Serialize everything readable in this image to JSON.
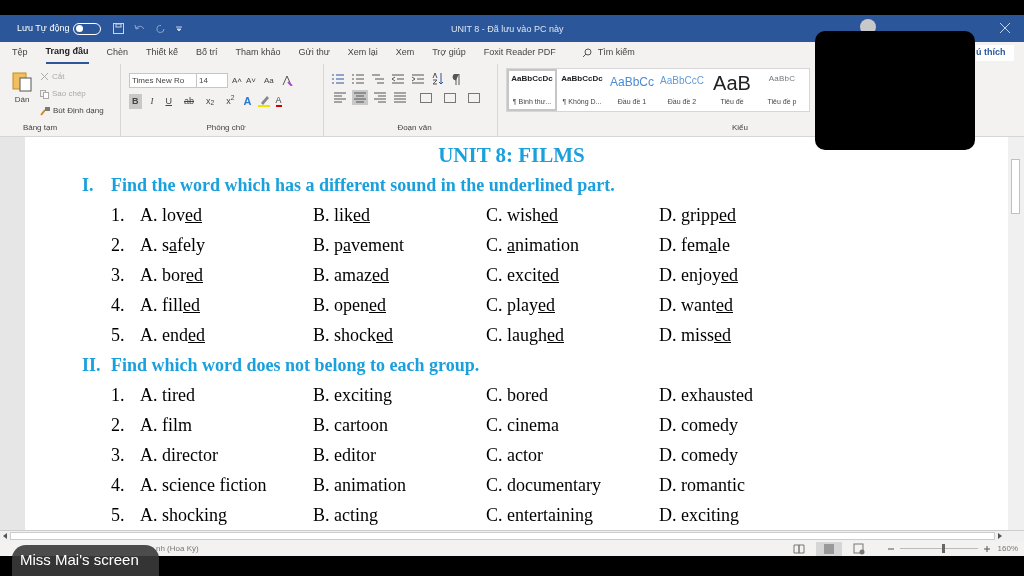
{
  "title_bar": {
    "autosave_label": "Lưu Tự động",
    "autosave_on": false,
    "title": "UNIT 8  -  Đã lưu vào PC này"
  },
  "menu_tabs": [
    {
      "label": "Tệp",
      "selected": false
    },
    {
      "label": "Trang đầu",
      "selected": true
    },
    {
      "label": "Chèn",
      "selected": false
    },
    {
      "label": "Thiết kế",
      "selected": false
    },
    {
      "label": "Bố trí",
      "selected": false
    },
    {
      "label": "Tham khảo",
      "selected": false
    },
    {
      "label": "Gửi thư",
      "selected": false
    },
    {
      "label": "Xem lại",
      "selected": false
    },
    {
      "label": "Xem",
      "selected": false
    },
    {
      "label": "Trợ giúp",
      "selected": false
    },
    {
      "label": "Foxit Reader PDF",
      "selected": false
    }
  ],
  "search": {
    "placeholder": "Tìm kiếm"
  },
  "comments_button": "ú thích",
  "ribbon": {
    "clipboard": {
      "paste": "Dán",
      "cut": "Cắt",
      "copy": "Sao chép",
      "format_painter": "Bút Định dạng",
      "group": "Bảng tạm"
    },
    "font": {
      "name": "Times New Ro",
      "size": "14",
      "size_buttons": [
        "A˄",
        "A˅"
      ],
      "text_effects": "A",
      "font_color": "A",
      "case": "Aa",
      "group": "Phông chữ",
      "format_buttons": [
        {
          "kind": "bold",
          "label": "B",
          "selected": true
        },
        {
          "kind": "italic",
          "label": "I",
          "selected": false
        },
        {
          "kind": "underline",
          "label": "U",
          "selected": false
        },
        {
          "kind": "strike",
          "label": "ab",
          "selected": false
        },
        {
          "kind": "subscript",
          "label": "x",
          "mark": "2",
          "selected": false
        },
        {
          "kind": "superscript",
          "label": "x",
          "mark": "2",
          "selected": false
        }
      ]
    },
    "paragraph": {
      "group": "Đoạn văn",
      "align_buttons": [
        {
          "kind": "left",
          "selected": false
        },
        {
          "kind": "center",
          "selected": true
        },
        {
          "kind": "right",
          "selected": false
        },
        {
          "kind": "justify",
          "selected": false
        }
      ]
    },
    "styles": {
      "group": "Kiểu",
      "items": [
        {
          "kind": "normal",
          "sample": "AaBbCcDc",
          "name": "¶ Bình thư...",
          "selected": true
        },
        {
          "kind": "normal",
          "sample": "AaBbCcDc",
          "name": "¶ Không D...",
          "selected": false
        },
        {
          "kind": "heading1",
          "sample": "AaBbCc",
          "name": "Đầu đề 1",
          "selected": false
        },
        {
          "kind": "heading2",
          "sample": "AaBbCcC",
          "name": "Đầu đề 2",
          "selected": false
        },
        {
          "kind": "title",
          "sample": "AaB",
          "name": "Tiêu đề",
          "selected": false
        },
        {
          "kind": "subtitle",
          "sample": "AaBbC",
          "name": "Tiêu đề p",
          "selected": false
        }
      ]
    }
  },
  "document": {
    "title": "UNIT 8: FILMS",
    "sections": [
      {
        "numeral": "I.",
        "heading": "Find the word which has a different sound in the underlined part.",
        "questions": [
          {
            "number": "1.",
            "options": [
              {
                "before": "A. lov",
                "underlined": "ed"
              },
              {
                "before": "B. lik",
                "underlined": "ed"
              },
              {
                "before": "C. wish",
                "underlined": "ed"
              },
              {
                "before": "D. gripp",
                "underlined": "ed"
              }
            ]
          },
          {
            "number": "2.",
            "options": [
              {
                "before": "A. s",
                "underlined": "a",
                "after": "fely"
              },
              {
                "before": "B. p",
                "underlined": "a",
                "after": "vement"
              },
              {
                "before": "C. ",
                "underlined": "a",
                "after": "nimation"
              },
              {
                "before": "D. fem",
                "underlined": "a",
                "after": "le"
              }
            ]
          },
          {
            "number": "3.",
            "options": [
              {
                "before": "A. bor",
                "underlined": "ed"
              },
              {
                "before": "B. amaz",
                "underlined": "ed"
              },
              {
                "before": "C. excit",
                "underlined": "ed"
              },
              {
                "before": "D. enjoy",
                "underlined": "ed"
              }
            ]
          },
          {
            "number": "4.",
            "options": [
              {
                "before": "A. fill",
                "underlined": "ed"
              },
              {
                "before": "B. open",
                "underlined": "ed"
              },
              {
                "before": "C. play",
                "underlined": "ed"
              },
              {
                "before": "D. want",
                "underlined": "ed"
              }
            ]
          },
          {
            "number": "5.",
            "options": [
              {
                "before": "A. end",
                "underlined": "ed"
              },
              {
                "before": "B. shock",
                "underlined": "ed"
              },
              {
                "before": "C. laugh",
                "underlined": "ed"
              },
              {
                "before": "D. miss",
                "underlined": "ed"
              }
            ]
          }
        ]
      },
      {
        "numeral": "II.",
        "heading": "Find which word does not belong to each group.",
        "questions": [
          {
            "number": "1.",
            "options": [
              {
                "before": "A. tired"
              },
              {
                "before": "B. exciting"
              },
              {
                "before": "C. bored"
              },
              {
                "before": "D. exhausted"
              }
            ]
          },
          {
            "number": "2.",
            "options": [
              {
                "before": "A. film"
              },
              {
                "before": "B. cartoon"
              },
              {
                "before": "C. cinema"
              },
              {
                "before": "D. comedy"
              }
            ]
          },
          {
            "number": "3.",
            "options": [
              {
                "before": "A. director"
              },
              {
                "before": "B. editor"
              },
              {
                "before": "C. actor"
              },
              {
                "before": "D. comedy"
              }
            ]
          },
          {
            "number": "4.",
            "options": [
              {
                "before": "A. science fiction"
              },
              {
                "before": "B. animation"
              },
              {
                "before": "C. documentary"
              },
              {
                "before": "D. romantic"
              }
            ]
          },
          {
            "number": "5.",
            "options": [
              {
                "before": "A. shocking"
              },
              {
                "before": "B. acting"
              },
              {
                "before": "C. entertaining"
              },
              {
                "before": "D. exciting"
              }
            ]
          }
        ]
      }
    ]
  },
  "status_bar": {
    "language": "nh (Hoa Kỳ)",
    "views": [
      {
        "kind": "read",
        "selected": false
      },
      {
        "kind": "print",
        "selected": true
      },
      {
        "kind": "web",
        "selected": false
      }
    ],
    "zoom": {
      "level": 0.57,
      "reading": "160%"
    }
  },
  "screen_share_label": "Miss Mai's screen"
}
